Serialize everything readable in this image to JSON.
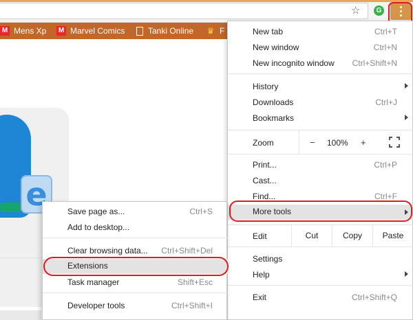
{
  "toolbar": {
    "star_icon": "bookmark-star-icon",
    "extension_badge": "G",
    "menu_icon": "three-dot-menu-icon"
  },
  "bookmarks": [
    {
      "label": "Mens Xp",
      "icon": "M"
    },
    {
      "label": "Marvel Comics",
      "icon": "M"
    },
    {
      "label": "Tanki Online",
      "icon": "page-icon"
    },
    {
      "label": "F",
      "icon": "crown-icon"
    }
  ],
  "menu": {
    "new_tab": {
      "label": "New tab",
      "shortcut": "Ctrl+T"
    },
    "new_window": {
      "label": "New window",
      "shortcut": "Ctrl+N"
    },
    "new_incognito": {
      "label": "New incognito window",
      "shortcut": "Ctrl+Shift+N"
    },
    "history": {
      "label": "History"
    },
    "downloads": {
      "label": "Downloads",
      "shortcut": "Ctrl+J"
    },
    "bookmarks": {
      "label": "Bookmarks"
    },
    "zoom": {
      "label": "Zoom",
      "minus": "−",
      "value": "100%",
      "plus": "+"
    },
    "print": {
      "label": "Print...",
      "shortcut": "Ctrl+P"
    },
    "cast": {
      "label": "Cast..."
    },
    "find": {
      "label": "Find...",
      "shortcut": "Ctrl+F"
    },
    "more_tools": {
      "label": "More tools"
    },
    "edit": {
      "label": "Edit",
      "cut": "Cut",
      "copy": "Copy",
      "paste": "Paste"
    },
    "settings": {
      "label": "Settings"
    },
    "help": {
      "label": "Help"
    },
    "exit": {
      "label": "Exit",
      "shortcut": "Ctrl+Shift+Q"
    }
  },
  "submenu": {
    "save_page": {
      "label": "Save page as...",
      "shortcut": "Ctrl+S"
    },
    "add_desktop": {
      "label": "Add to desktop..."
    },
    "clear_browsing": {
      "label": "Clear browsing data...",
      "shortcut": "Ctrl+Shift+Del"
    },
    "extensions": {
      "label": "Extensions"
    },
    "task_manager": {
      "label": "Task manager",
      "shortcut": "Shift+Esc"
    },
    "developer_tools": {
      "label": "Developer tools",
      "shortcut": "Ctrl+Shift+I"
    }
  },
  "page": {
    "letter": "e"
  },
  "colors": {
    "accent": "#c2662a",
    "highlight": "#e01b1b",
    "menu_button": "#d5954b"
  }
}
